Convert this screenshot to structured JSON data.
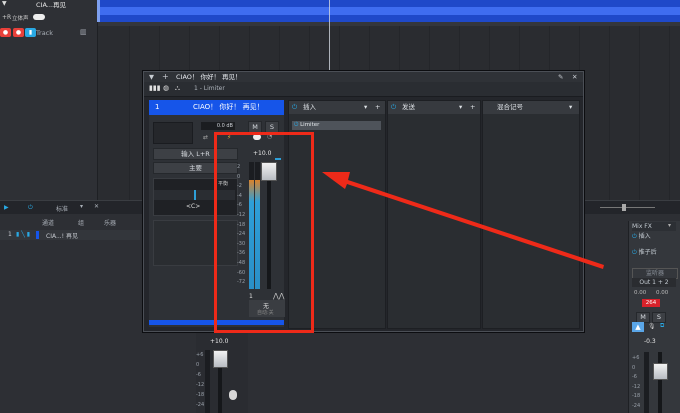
{
  "background": {
    "top_title": "CIA...再见",
    "stereo_label": "立体声",
    "track_label": "Track",
    "lr_label": "+R",
    "mixer_columns": [
      "通道",
      "组",
      "乐器"
    ],
    "mixer_std_label": "标准",
    "mixer_track_name": "CIA...! 再见",
    "mixer_track_number": "1"
  },
  "window": {
    "title": "CIAO！ 你好！ 再见！",
    "preset_label": "1 - Limiter"
  },
  "channel": {
    "number": "1",
    "name": "CIAO！ 你好！ 再见！",
    "gain_value": "0.0 dB",
    "mute": "M",
    "solo": "S",
    "input_label": "输入 L+R",
    "output_label": "主要",
    "pan_label": "平衡",
    "pan_value": "<C>",
    "fader_value": "+10.0",
    "channel_number_small": "1",
    "automation_label": "无",
    "automation_sub": "自动:关"
  },
  "panels": {
    "inserts_title": "插入",
    "inserts_item": "Limiter",
    "sends_title": "发送",
    "mixscene_title": "混合记号"
  },
  "db_scale": [
    "+10.0",
    "2",
    "0",
    "-2",
    "-4",
    "-6",
    "-12",
    "-18",
    "-24",
    "-30",
    "-36",
    "-48",
    "-60",
    "-72"
  ],
  "right_strip": {
    "mix_fx": "Mix FX",
    "insert": "插入",
    "send_after": "推子后",
    "monitor": "监听器",
    "output": "Out 1 + 2",
    "value1": "0.00",
    "value2": "0.00",
    "value3": "264",
    "mute": "M",
    "solo": "S",
    "fader_value": "-0.3",
    "scale": [
      "+6",
      "0",
      "-6",
      "-12",
      "-18",
      "-24"
    ]
  },
  "bottom_strip": {
    "fader_value": "+10.0",
    "scale": [
      "+6",
      "0",
      "-6",
      "-12",
      "-18",
      "-24"
    ]
  },
  "colors": {
    "accent_blue": "#1655e9",
    "highlight_red": "#ee2a19",
    "waveform_blue": "#1f49c9"
  }
}
